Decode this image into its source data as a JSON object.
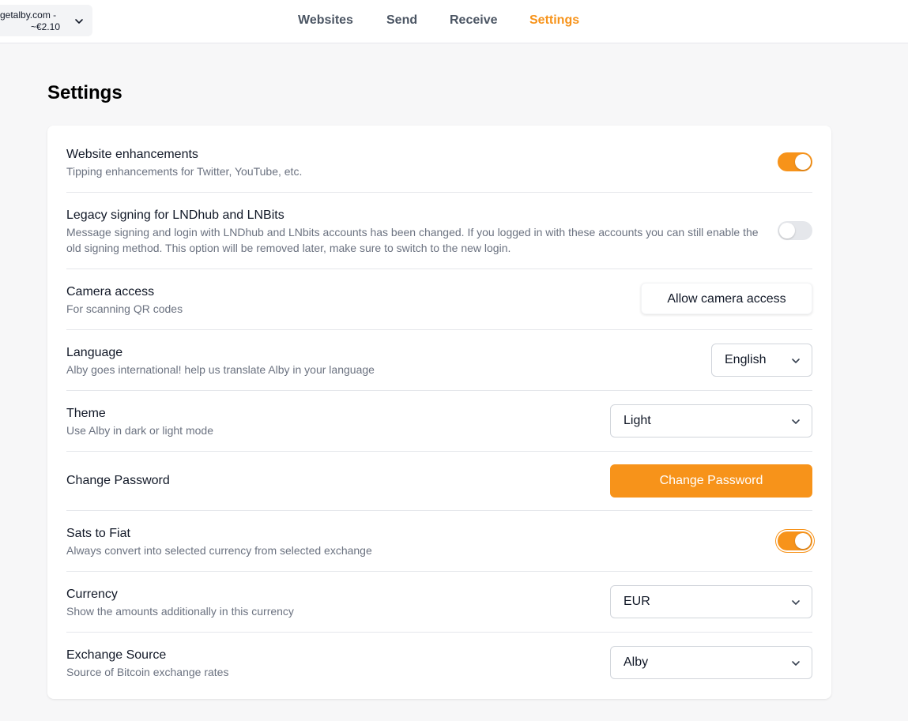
{
  "account": {
    "line1": "getalby.com -",
    "line2": "~€2.10"
  },
  "nav": {
    "websites": "Websites",
    "send": "Send",
    "receive": "Receive",
    "settings": "Settings"
  },
  "colors": {
    "accent": "#f7931a",
    "toggle_off": "#e5e7eb"
  },
  "page": {
    "title": "Settings"
  },
  "settings": {
    "website_enhancements": {
      "title": "Website enhancements",
      "desc": "Tipping enhancements for Twitter, YouTube, etc.",
      "enabled": true
    },
    "legacy_signing": {
      "title": "Legacy signing for LNDhub and LNBits",
      "desc": "Message signing and login with LNDhub and LNbits accounts has been changed. If you logged in with these accounts you can still enable the old signing method. This option will be removed later, make sure to switch to the new login.",
      "enabled": false
    },
    "camera": {
      "title": "Camera access",
      "desc": "For scanning QR codes",
      "button": "Allow camera access"
    },
    "language": {
      "title": "Language",
      "desc": "Alby goes international! help us translate Alby in your language",
      "value": "English"
    },
    "theme": {
      "title": "Theme",
      "desc": "Use Alby in dark or light mode",
      "value": "Light"
    },
    "password": {
      "title": "Change Password",
      "button": "Change Password"
    },
    "sats_to_fiat": {
      "title": "Sats to Fiat",
      "desc": "Always convert into selected currency from selected exchange",
      "enabled": true
    },
    "currency": {
      "title": "Currency",
      "desc": "Show the amounts additionally in this currency",
      "value": "EUR"
    },
    "exchange": {
      "title": "Exchange Source",
      "desc": "Source of Bitcoin exchange rates",
      "value": "Alby"
    }
  }
}
